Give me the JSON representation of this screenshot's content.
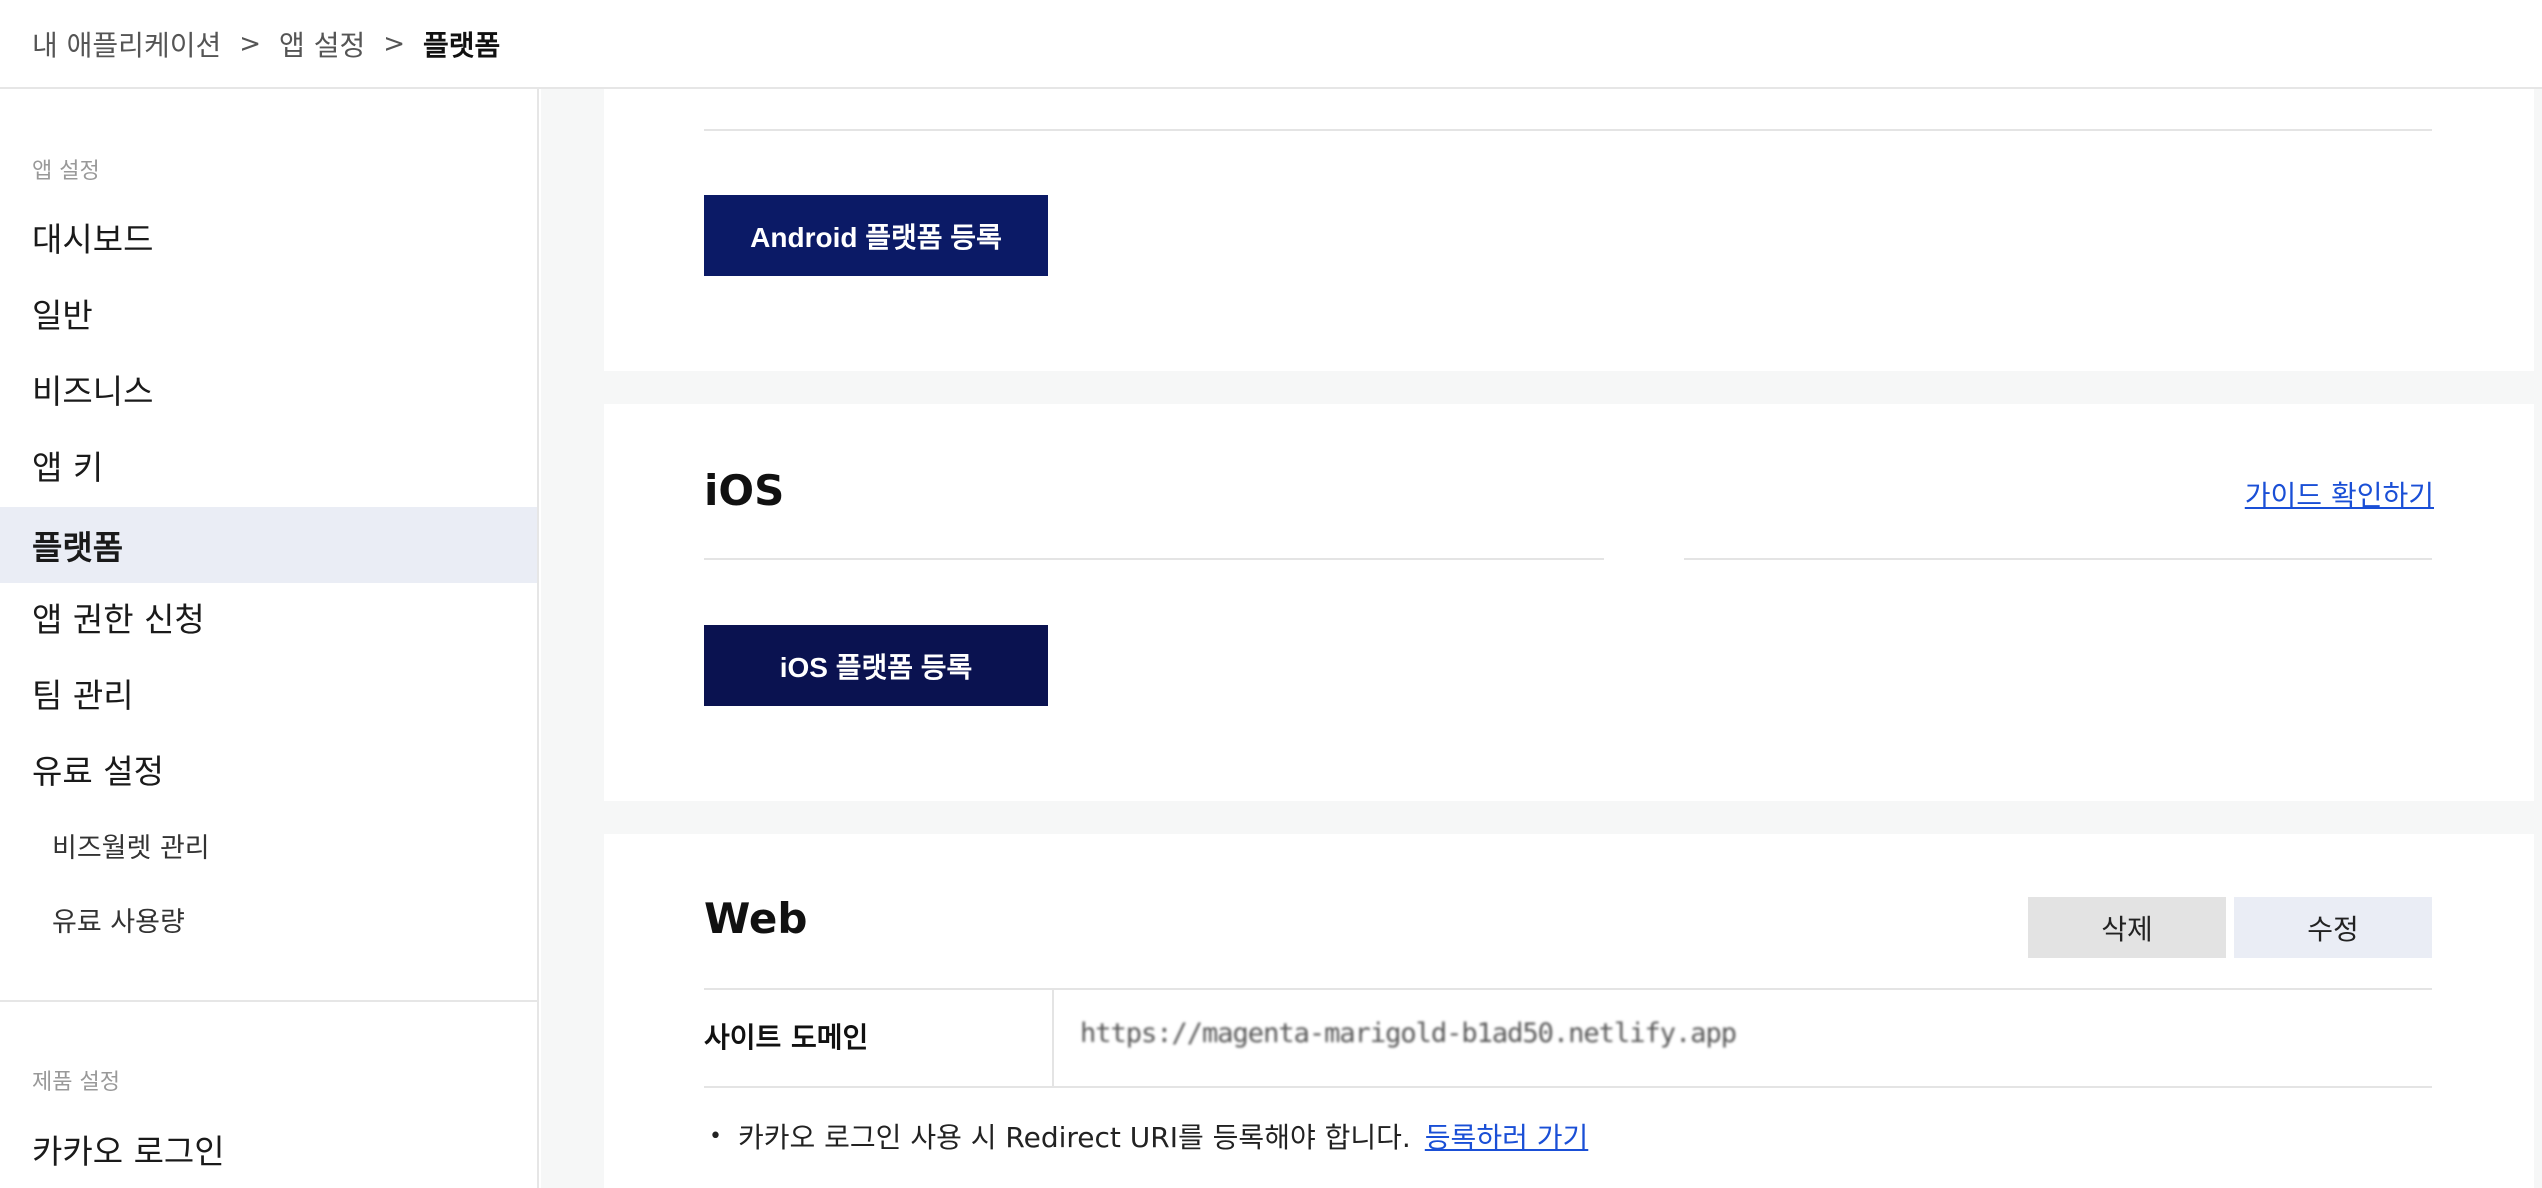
{
  "breadcrumb": {
    "items": [
      "내 애플리케이션",
      "앱 설정",
      "플랫폼"
    ],
    "separator": ">"
  },
  "sidebar": {
    "app_settings_label": "앱 설정",
    "items": [
      {
        "label": "대시보드",
        "active": false
      },
      {
        "label": "일반",
        "active": false
      },
      {
        "label": "비즈니스",
        "active": false
      },
      {
        "label": "앱 키",
        "active": false
      },
      {
        "label": "플랫폼",
        "active": true
      },
      {
        "label": "앱 권한 신청",
        "active": false
      },
      {
        "label": "팀 관리",
        "active": false
      },
      {
        "label": "유료 설정",
        "active": false
      }
    ],
    "sub_items": [
      "비즈월렛 관리",
      "유료 사용량"
    ],
    "product_settings_label": "제품 설정",
    "product_items": [
      "카카오 로그인"
    ]
  },
  "android": {
    "register_label": "Android 플랫폼 등록"
  },
  "ios": {
    "title": "iOS",
    "guide_label": "가이드 확인하기",
    "register_label": "iOS 플랫폼 등록"
  },
  "web": {
    "title": "Web",
    "delete_label": "삭제",
    "edit_label": "수정",
    "site_domain_label": "사이트 도메인",
    "site_domain_value": "https://magenta-marigold-b1ad50.netlify.app",
    "note_bullet": "•",
    "note_text": "카카오 로그인 사용 시 Redirect URI를 등록해야 합니다.",
    "note_link": "등록하러 가기"
  },
  "colors": {
    "primary_button": "#0b1a66",
    "link": "#1a4fd6",
    "active_nav_bg": "#eaedf5"
  }
}
